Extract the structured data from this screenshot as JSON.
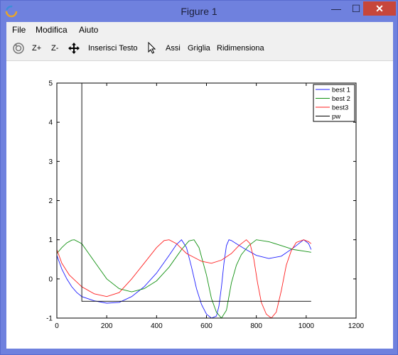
{
  "window": {
    "title": "Figure 1"
  },
  "window_controls": {
    "minimize": "—",
    "maximize": "☐",
    "close": "✕"
  },
  "menu": [
    "File",
    "Modifica",
    "Aiuto"
  ],
  "toolbar": {
    "zoom_in": "Z+",
    "zoom_out": "Z-",
    "insert_text": "Inserisci Testo",
    "axes": "Assi",
    "grid": "Griglia",
    "resize": "Ridimensiona"
  },
  "colors": {
    "best1": "#1f1fff",
    "best2": "#119111",
    "best3": "#ff1f1f",
    "pw": "#000000"
  },
  "chart_data": {
    "type": "line",
    "xlim": [
      0,
      1200
    ],
    "ylim": [
      -1,
      5
    ],
    "xticks": [
      0,
      200,
      400,
      600,
      800,
      1000,
      1200
    ],
    "yticks": [
      -1,
      0,
      1,
      2,
      3,
      4,
      5
    ],
    "legend_position": "top-right",
    "grid": false,
    "series": [
      {
        "name": "best 1",
        "x": [
          0,
          20,
          40,
          60,
          80,
          100,
          150,
          200,
          250,
          300,
          350,
          400,
          450,
          480,
          500,
          520,
          540,
          560,
          580,
          600,
          620,
          640,
          650,
          660,
          670,
          680,
          690,
          700,
          720,
          750,
          800,
          850,
          900,
          950,
          990,
          1010,
          1020
        ],
        "y": [
          0.6,
          0.25,
          0.0,
          -0.2,
          -0.35,
          -0.45,
          -0.56,
          -0.62,
          -0.6,
          -0.45,
          -0.2,
          0.15,
          0.6,
          0.88,
          1.0,
          0.8,
          0.3,
          -0.25,
          -0.65,
          -0.9,
          -1.0,
          -0.95,
          -0.7,
          -0.2,
          0.4,
          0.85,
          1.0,
          0.98,
          0.9,
          0.78,
          0.6,
          0.52,
          0.58,
          0.8,
          1.0,
          0.9,
          0.75
        ]
      },
      {
        "name": "best 2",
        "x": [
          0,
          20,
          40,
          60,
          70,
          100,
          150,
          200,
          250,
          300,
          350,
          400,
          450,
          500,
          530,
          550,
          570,
          600,
          620,
          640,
          660,
          680,
          700,
          720,
          740,
          770,
          800,
          850,
          900,
          950,
          1000,
          1020
        ],
        "y": [
          0.65,
          0.8,
          0.92,
          0.99,
          1.0,
          0.9,
          0.45,
          0.0,
          -0.25,
          -0.33,
          -0.25,
          -0.05,
          0.3,
          0.75,
          0.97,
          1.0,
          0.8,
          0.1,
          -0.5,
          -0.85,
          -1.0,
          -0.8,
          -0.1,
          0.35,
          0.62,
          0.85,
          1.0,
          0.95,
          0.85,
          0.75,
          0.7,
          0.68
        ]
      },
      {
        "name": "best3",
        "x": [
          0,
          20,
          50,
          100,
          150,
          200,
          250,
          300,
          350,
          400,
          430,
          450,
          480,
          520,
          580,
          620,
          660,
          700,
          730,
          760,
          775,
          790,
          805,
          820,
          840,
          860,
          880,
          900,
          920,
          940,
          960,
          990,
          1010,
          1020
        ],
        "y": [
          0.75,
          0.4,
          0.1,
          -0.2,
          -0.38,
          -0.45,
          -0.35,
          0.0,
          0.4,
          0.8,
          0.98,
          1.0,
          0.9,
          0.65,
          0.45,
          0.4,
          0.48,
          0.65,
          0.85,
          1.0,
          0.9,
          0.5,
          -0.1,
          -0.6,
          -0.9,
          -1.0,
          -0.85,
          -0.3,
          0.35,
          0.72,
          0.93,
          1.0,
          0.95,
          0.9
        ]
      },
      {
        "name": "pw",
        "x": [
          100,
          100,
          100,
          1020
        ],
        "y": [
          5,
          -0.57,
          -0.57,
          -0.57
        ]
      }
    ]
  }
}
